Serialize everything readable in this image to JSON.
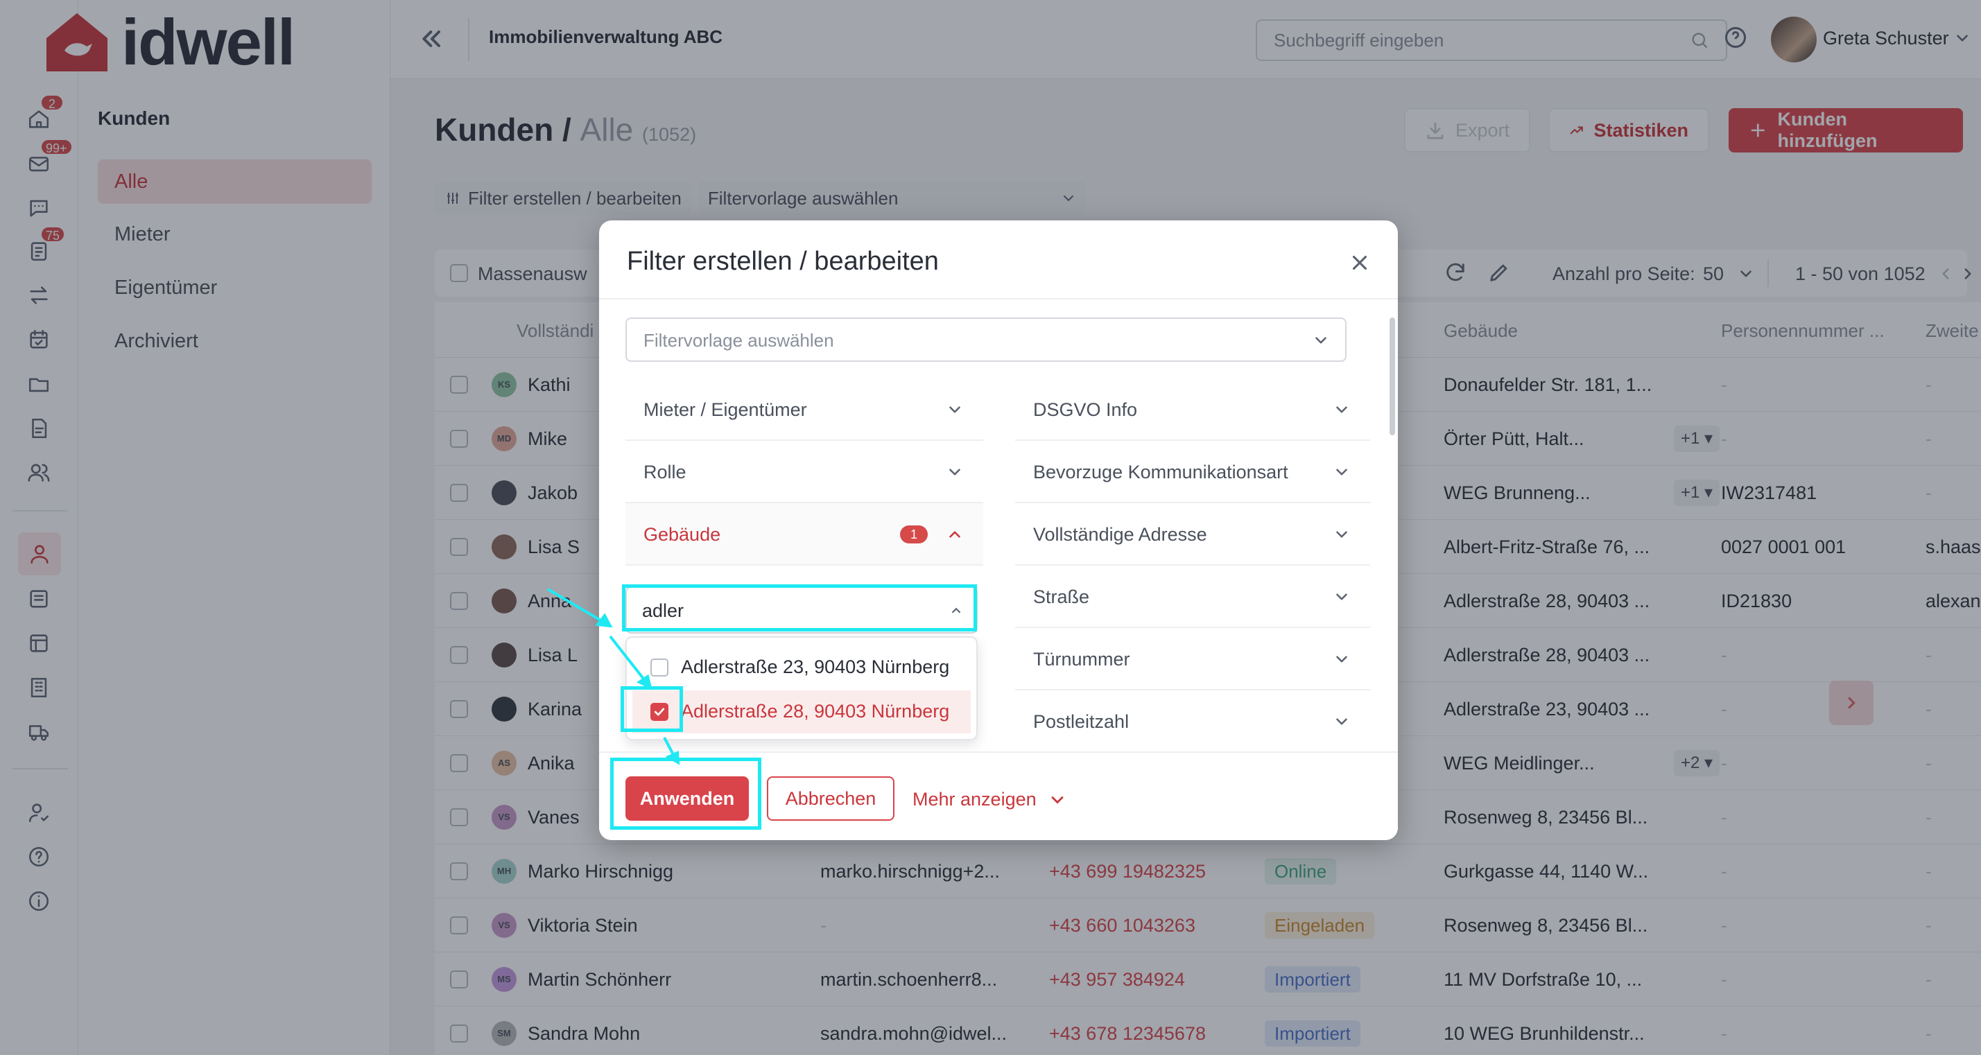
{
  "app": {
    "logo_text": "idwell",
    "company": "Immobilienverwaltung ABC"
  },
  "rail": {
    "badges": {
      "home": "2",
      "mail": "99+",
      "tasks": "75"
    }
  },
  "subnav": {
    "title": "Kunden",
    "items": [
      "Alle",
      "Mieter",
      "Eigentümer",
      "Archiviert"
    ]
  },
  "topbar": {
    "search_placeholder": "Suchbegriff eingeben",
    "user_name": "Greta Schuster"
  },
  "page": {
    "title": "Kunden",
    "sep": " / ",
    "subtitle": "Alle",
    "count": "(1052)"
  },
  "header_buttons": {
    "export": "Export",
    "stats": "Statistiken",
    "add": "Kunden hinzufügen"
  },
  "filter_bar": {
    "edit_label": "Filter erstellen / bearbeiten",
    "preset_label": "Filtervorlage auswählen"
  },
  "toolbar": {
    "mass_label": "Massenausw",
    "per_page_label": "Anzahl pro Seite:",
    "per_page_value": "50",
    "range": "1 - 50 von 1052"
  },
  "table": {
    "columns": [
      "Vollständi",
      "Gebäude",
      "Personennummer ...",
      "Zweite E-"
    ],
    "rows": [
      {
        "initials": "KS",
        "avatar_color": "#8fc7a4",
        "name": "Kathi",
        "email": "",
        "phone": "",
        "status": "",
        "building": "Donaufelder Str. 181, 1...",
        "plus": "",
        "pnum": "-",
        "email2": "-"
      },
      {
        "initials": "MD",
        "avatar_color": "#e3a99a",
        "name": "Mike",
        "email": "",
        "phone": "",
        "status": "",
        "building": "Örter Pütt, Halt...",
        "plus": "+1",
        "pnum": "-",
        "email2": "-"
      },
      {
        "initials": "",
        "avatar_color": "#4b4f58",
        "name": "Jakob",
        "email": "",
        "phone": "",
        "status": "",
        "building": "WEG Brunneng...",
        "plus": "+1",
        "pnum": "IW2317481",
        "email2": "-"
      },
      {
        "initials": "",
        "avatar_color": "#8c6a5b",
        "name": "Lisa S",
        "email": "",
        "phone": "",
        "status": "",
        "building": "Albert-Fritz-Straße 76, ...",
        "plus": "",
        "pnum": "0027 0001 001",
        "email2": "s.haas@"
      },
      {
        "initials": "",
        "avatar_color": "#7a5b50",
        "name": "Anna",
        "email": "",
        "phone": "",
        "status": "",
        "building": "Adlerstraße 28, 90403 ...",
        "plus": "",
        "pnum": "ID21830",
        "email2": "alexande"
      },
      {
        "initials": "",
        "avatar_color": "#5a4b48",
        "name": "Lisa L",
        "email": "",
        "phone": "",
        "status": "",
        "building": "Adlerstraße 28, 90403 ...",
        "plus": "",
        "pnum": "-",
        "email2": "-"
      },
      {
        "initials": "",
        "avatar_color": "#33373d",
        "name": "Karina",
        "email": "",
        "phone": "",
        "status": "",
        "building": "Adlerstraße 23, 90403 ...",
        "plus": "",
        "pnum": "-",
        "email2": "-"
      },
      {
        "initials": "AS",
        "avatar_color": "#e8c1a3",
        "name": "Anika",
        "email": "",
        "phone": "",
        "status": "",
        "building": "WEG Meidlinger...",
        "plus": "+2",
        "pnum": "-",
        "email2": "-"
      },
      {
        "initials": "VS",
        "avatar_color": "#c79ac9",
        "name": "Vanes",
        "email": "",
        "phone": "",
        "status": "",
        "building": "Rosenweg 8, 23456 Bl...",
        "plus": "",
        "pnum": "-",
        "email2": "-"
      },
      {
        "initials": "MH",
        "avatar_color": "#a7d6cf",
        "name": "Marko Hirschnigg",
        "email": "marko.hirschnigg+2...",
        "phone": "+43 699 19482325",
        "status": "Online",
        "building": "Gurkgasse 44, 1140 W...",
        "plus": "",
        "pnum": "-",
        "email2": "-"
      },
      {
        "initials": "VS",
        "avatar_color": "#c79ac9",
        "name": "Viktoria Stein",
        "email": "-",
        "phone": "+43 660 1043263",
        "status": "Eingeladen",
        "building": "Rosenweg 8, 23456 Bl...",
        "plus": "",
        "pnum": "-",
        "email2": "-"
      },
      {
        "initials": "MS",
        "avatar_color": "#c49ae0",
        "name": "Martin Schönherr",
        "email": "martin.schoenherr8...",
        "phone": "+43 957 384924",
        "status": "Importiert",
        "building": "11 MV Dorfstraße 10, ...",
        "plus": "",
        "pnum": "-",
        "email2": "-"
      },
      {
        "initials": "SM",
        "avatar_color": "#b7b7b7",
        "name": "Sandra Mohn",
        "email": "sandra.mohn@idwel...",
        "phone": "+43 678 12345678",
        "status": "Importiert",
        "building": "10 WEG Brunhildenstr...",
        "plus": "",
        "pnum": "-",
        "email2": "-"
      }
    ]
  },
  "modal": {
    "title": "Filter erstellen / bearbeiten",
    "preset_placeholder": "Filtervorlage auswählen",
    "left_filters": [
      "Mieter / Eigentümer",
      "Rolle",
      "Gebäude"
    ],
    "right_filters": [
      "DSGVO Info",
      "Bevorzuge Kommunikationsart",
      "Vollständige Adresse",
      "Straße",
      "Türnummer",
      "Postleitzahl"
    ],
    "building_count": "1",
    "combo_value": "adler",
    "options": [
      {
        "label": "Adlerstraße 23, 90403 Nürnberg",
        "checked": false
      },
      {
        "label": "Adlerstraße 28, 90403 Nürnberg",
        "checked": true
      }
    ],
    "apply": "Anwenden",
    "cancel": "Abbrechen",
    "more": "Mehr anzeigen"
  },
  "colors": {
    "accent": "#d9444a",
    "highlight": "#1ee9f2"
  }
}
